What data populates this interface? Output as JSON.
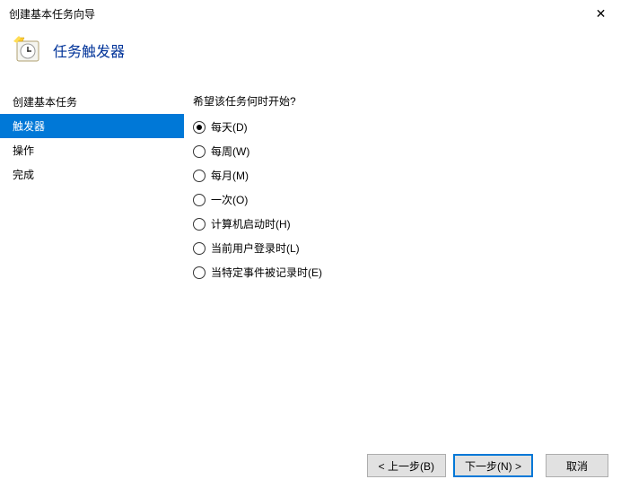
{
  "window": {
    "title": "创建基本任务向导",
    "close_symbol": "✕"
  },
  "header": {
    "page_title": "任务触发器"
  },
  "sidebar": {
    "items": [
      {
        "label": "创建基本任务",
        "active": false
      },
      {
        "label": "触发器",
        "active": true
      },
      {
        "label": "操作",
        "active": false
      },
      {
        "label": "完成",
        "active": false
      }
    ]
  },
  "main": {
    "question": "希望该任务何时开始?",
    "options": [
      {
        "label": "每天(D)",
        "checked": true
      },
      {
        "label": "每周(W)",
        "checked": false
      },
      {
        "label": "每月(M)",
        "checked": false
      },
      {
        "label": "一次(O)",
        "checked": false
      },
      {
        "label": "计算机启动时(H)",
        "checked": false
      },
      {
        "label": "当前用户登录时(L)",
        "checked": false
      },
      {
        "label": "当特定事件被记录时(E)",
        "checked": false
      }
    ]
  },
  "buttons": {
    "back": "< 上一步(B)",
    "next": "下一步(N) >",
    "cancel": "取消"
  }
}
